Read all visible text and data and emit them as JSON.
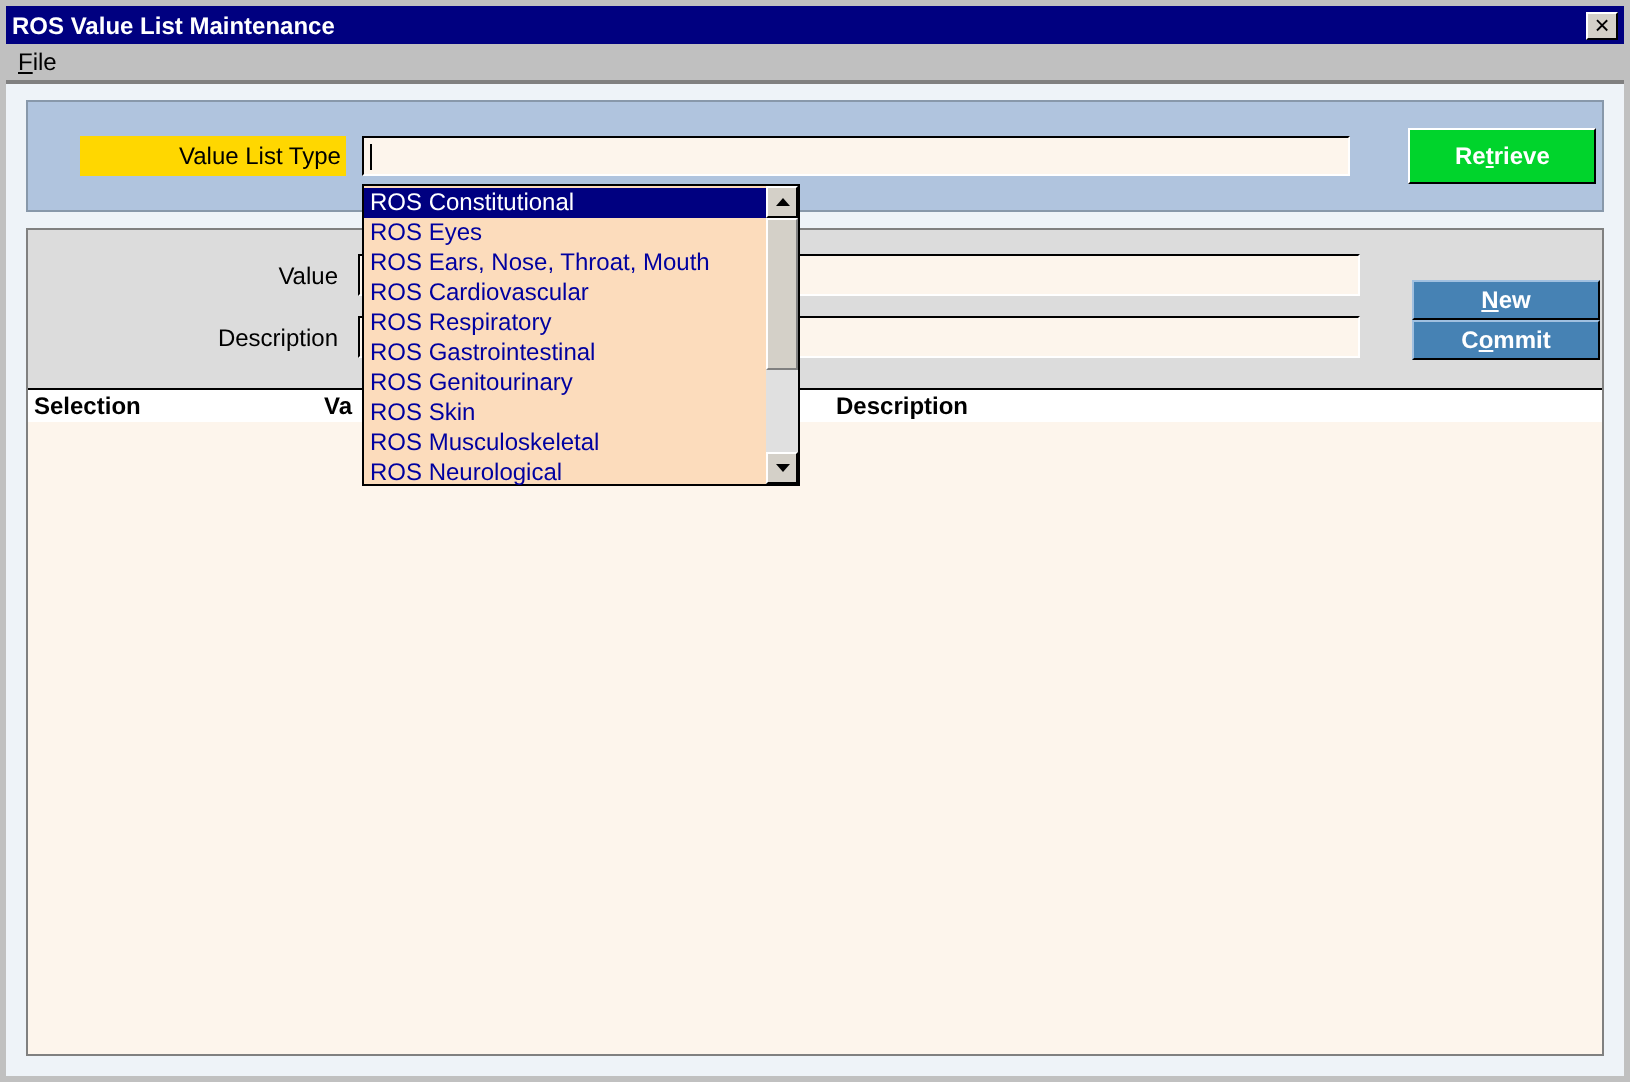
{
  "window": {
    "title": "ROS Value List Maintenance",
    "close": "×"
  },
  "menu": [
    {
      "label": {
        "key": "F",
        "after": "ile"
      }
    }
  ],
  "filter": {
    "label": "Value List Type",
    "button": {
      "label": {
        "before": "Re",
        "key": "t",
        "after": "rieve"
      }
    }
  },
  "dropdown": {
    "items": [
      {
        "label": "ROS Constitutional",
        "selected": true
      },
      {
        "label": "ROS Eyes",
        "selected": false
      },
      {
        "label": "ROS Ears, Nose, Throat, Mouth",
        "selected": false
      },
      {
        "label": "ROS Cardiovascular",
        "selected": false
      },
      {
        "label": "ROS Respiratory",
        "selected": false
      },
      {
        "label": "ROS Gastrointestinal",
        "selected": false
      },
      {
        "label": "ROS Genitourinary",
        "selected": false
      },
      {
        "label": "ROS Skin",
        "selected": false
      },
      {
        "label": "ROS Musculoskeletal",
        "selected": false
      },
      {
        "label": "ROS Neurological",
        "selected": false
      }
    ]
  },
  "editor": {
    "fields": [
      {
        "label": "Value"
      },
      {
        "label": "Description"
      }
    ],
    "buttons": [
      {
        "label": {
          "key": "N",
          "after": "ew"
        }
      },
      {
        "label": {
          "before": "C",
          "key": "o",
          "after": "mmit"
        }
      }
    ]
  },
  "table": {
    "columns": [
      "Selection",
      "Va",
      "Description"
    ]
  }
}
